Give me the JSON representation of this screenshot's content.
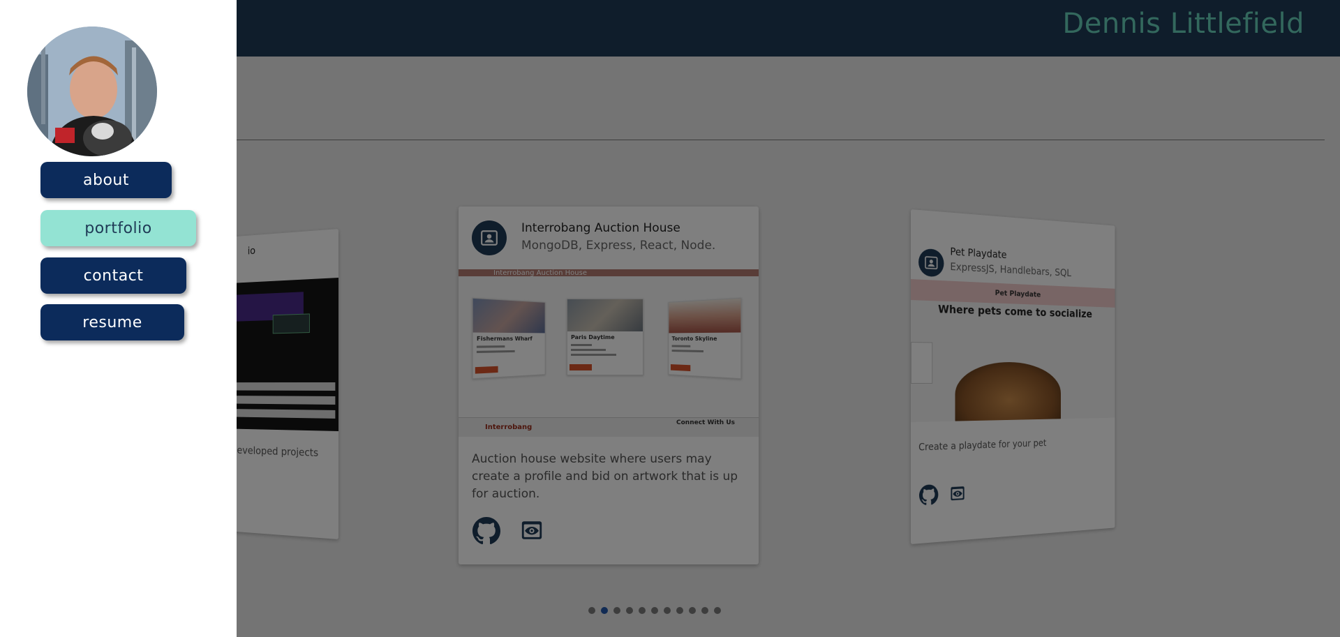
{
  "header": {
    "name": "Dennis Littlefield"
  },
  "nav": {
    "items": [
      {
        "label": "about",
        "active": false
      },
      {
        "label": "portfolio",
        "active": true
      },
      {
        "label": "contact",
        "active": false
      },
      {
        "label": "resume",
        "active": false
      }
    ]
  },
  "cards": {
    "left": {
      "title_fragment": "io",
      "desc_fragment": "eveloped projects"
    },
    "center": {
      "title": "Interrobang Auction House",
      "tech": "MongoDB, Express, React, Node.",
      "description": "Auction house website where users may create a profile and bid on artwork that is up for auction.",
      "screenshot": {
        "bar_text": "Interrobang Auction House",
        "items": [
          {
            "title": "Fishermans Wharf"
          },
          {
            "title": "Paris Daytime"
          },
          {
            "title": "Toronto Skyline"
          }
        ],
        "footer_brand": "Interrobang",
        "footer_connect": "Connect With Us"
      },
      "icons": [
        "github-icon",
        "eye-icon"
      ]
    },
    "right": {
      "title": "Pet Playdate",
      "tech": "ExpressJS, Handlebars, SQL",
      "screenshot": {
        "brand": "Pet Playdate",
        "headline": "Where pets come to socialize"
      },
      "description": "Create a playdate for your pet",
      "icons": [
        "github-icon",
        "eye-icon"
      ]
    }
  },
  "carousel": {
    "count": 11,
    "active_index": 1
  },
  "colors": {
    "header_bg": "#1f3a56",
    "header_text": "#66d1ba",
    "nav_button": "#0c2b5b",
    "nav_active": "#93e3d3",
    "dot_active": "#2257a8"
  }
}
